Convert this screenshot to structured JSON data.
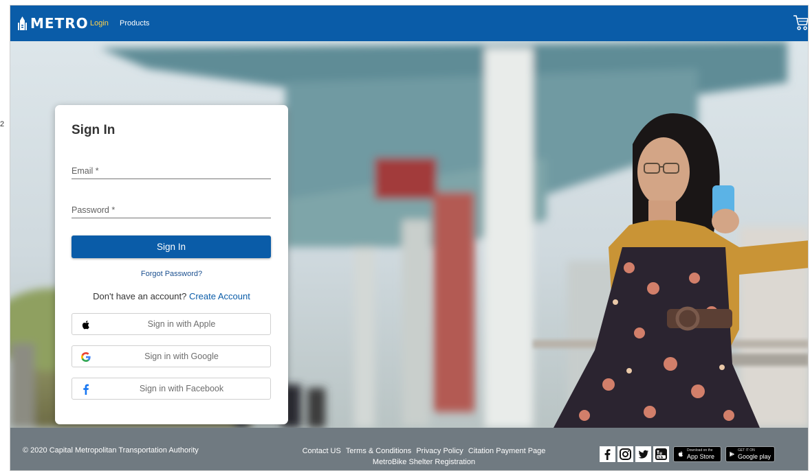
{
  "header": {
    "logo_text": "METRO",
    "nav": [
      {
        "label": "Login",
        "color": "#ffd24a"
      },
      {
        "label": "Products",
        "color": "#ffffff"
      }
    ],
    "icons": [
      "metro-logo-icon",
      "cart-icon"
    ],
    "background_color": "#0a5ca8"
  },
  "signin": {
    "title": "Sign In",
    "email": {
      "label": "Email *",
      "value": ""
    },
    "password": {
      "label": "Password *",
      "value": ""
    },
    "submit_label": "Sign In",
    "forgot_password": "Forgot Password?",
    "signup_prompt": "Don't have an account?",
    "signup_link": "Create Account",
    "social": [
      {
        "icon": "apple-icon",
        "label": "Sign in with Apple"
      },
      {
        "icon": "google-icon",
        "label": "Sign in with Google"
      },
      {
        "icon": "facebook-icon",
        "label": "Sign in with Facebook"
      }
    ]
  },
  "footer": {
    "copyright": "© 2020 Capital Metropolitan Transportation Authority",
    "links": [
      "Contact US",
      "Terms & Conditions",
      "Privacy Policy",
      "Citation Payment Page",
      "MetroBike Shelter Registration"
    ],
    "social_icons": [
      "facebook-icon",
      "instagram-icon",
      "twitter-icon",
      "youtube-icon"
    ],
    "app_store": {
      "small": "Download on the",
      "big": "App Store"
    },
    "google_play": {
      "small": "GET IT ON",
      "big": "Google play"
    },
    "background_color": "#707a81"
  },
  "colors": {
    "accent": "#0a5ca8",
    "login_highlight": "#ffd24a"
  }
}
